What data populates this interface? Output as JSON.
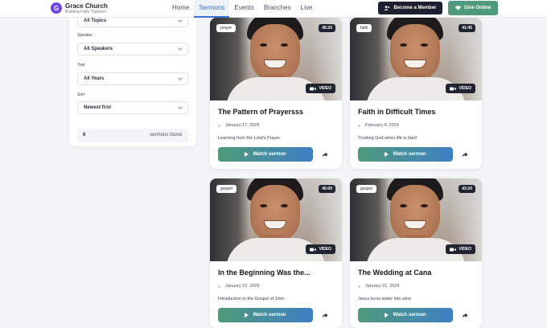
{
  "header": {
    "logo_letter": "G",
    "brand_name": "Grace Church",
    "brand_tagline": "Building Faith Together",
    "nav": [
      {
        "label": "Home",
        "active": false
      },
      {
        "label": "Sermons",
        "active": true
      },
      {
        "label": "Events",
        "active": false
      },
      {
        "label": "Branches",
        "active": false
      },
      {
        "label": "Live",
        "active": false
      }
    ],
    "member_button": "Become a Member",
    "give_button": "Give Online"
  },
  "filters": {
    "topic_value": "All Topics",
    "speaker_label": "Speaker",
    "speaker_value": "All Speakers",
    "year_label": "Year",
    "year_value": "All Years",
    "sort_label": "Sort",
    "sort_value": "Newest first",
    "count": "6",
    "count_text": "sermons found"
  },
  "cards": [
    {
      "tag": "prayer",
      "duration": "45:20",
      "video_badge": "VIDEO",
      "title": "The Pattern of Prayersss",
      "date": "January 17, 2026",
      "description": "Learning from the Lord's Prayer",
      "watch_label": "Watch sermon"
    },
    {
      "tag": "faith",
      "duration": "41:45",
      "video_badge": "VIDEO",
      "title": "Faith in Difficult Times",
      "date": "February 4, 2024",
      "description": "Trusting God when life is hard",
      "watch_label": "Watch sermon"
    },
    {
      "tag": "gospel",
      "duration": "40:00",
      "video_badge": "VIDEO",
      "title": "In the Beginning Was the...",
      "date": "January 13, 2026",
      "description": "Introduction to the Gospel of John",
      "watch_label": "Watch sermon"
    },
    {
      "tag": "gospel",
      "duration": "43:20",
      "video_badge": "VIDEO",
      "title": "The Wedding at Cana",
      "date": "January 21, 2024",
      "description": "Jesus turns water into wine",
      "watch_label": "Watch sermon"
    }
  ],
  "colors": {
    "accent": "#3a6fd8",
    "brand": "#6b46e0",
    "give": "#4d9b7a",
    "dark": "#1b1f2e"
  }
}
